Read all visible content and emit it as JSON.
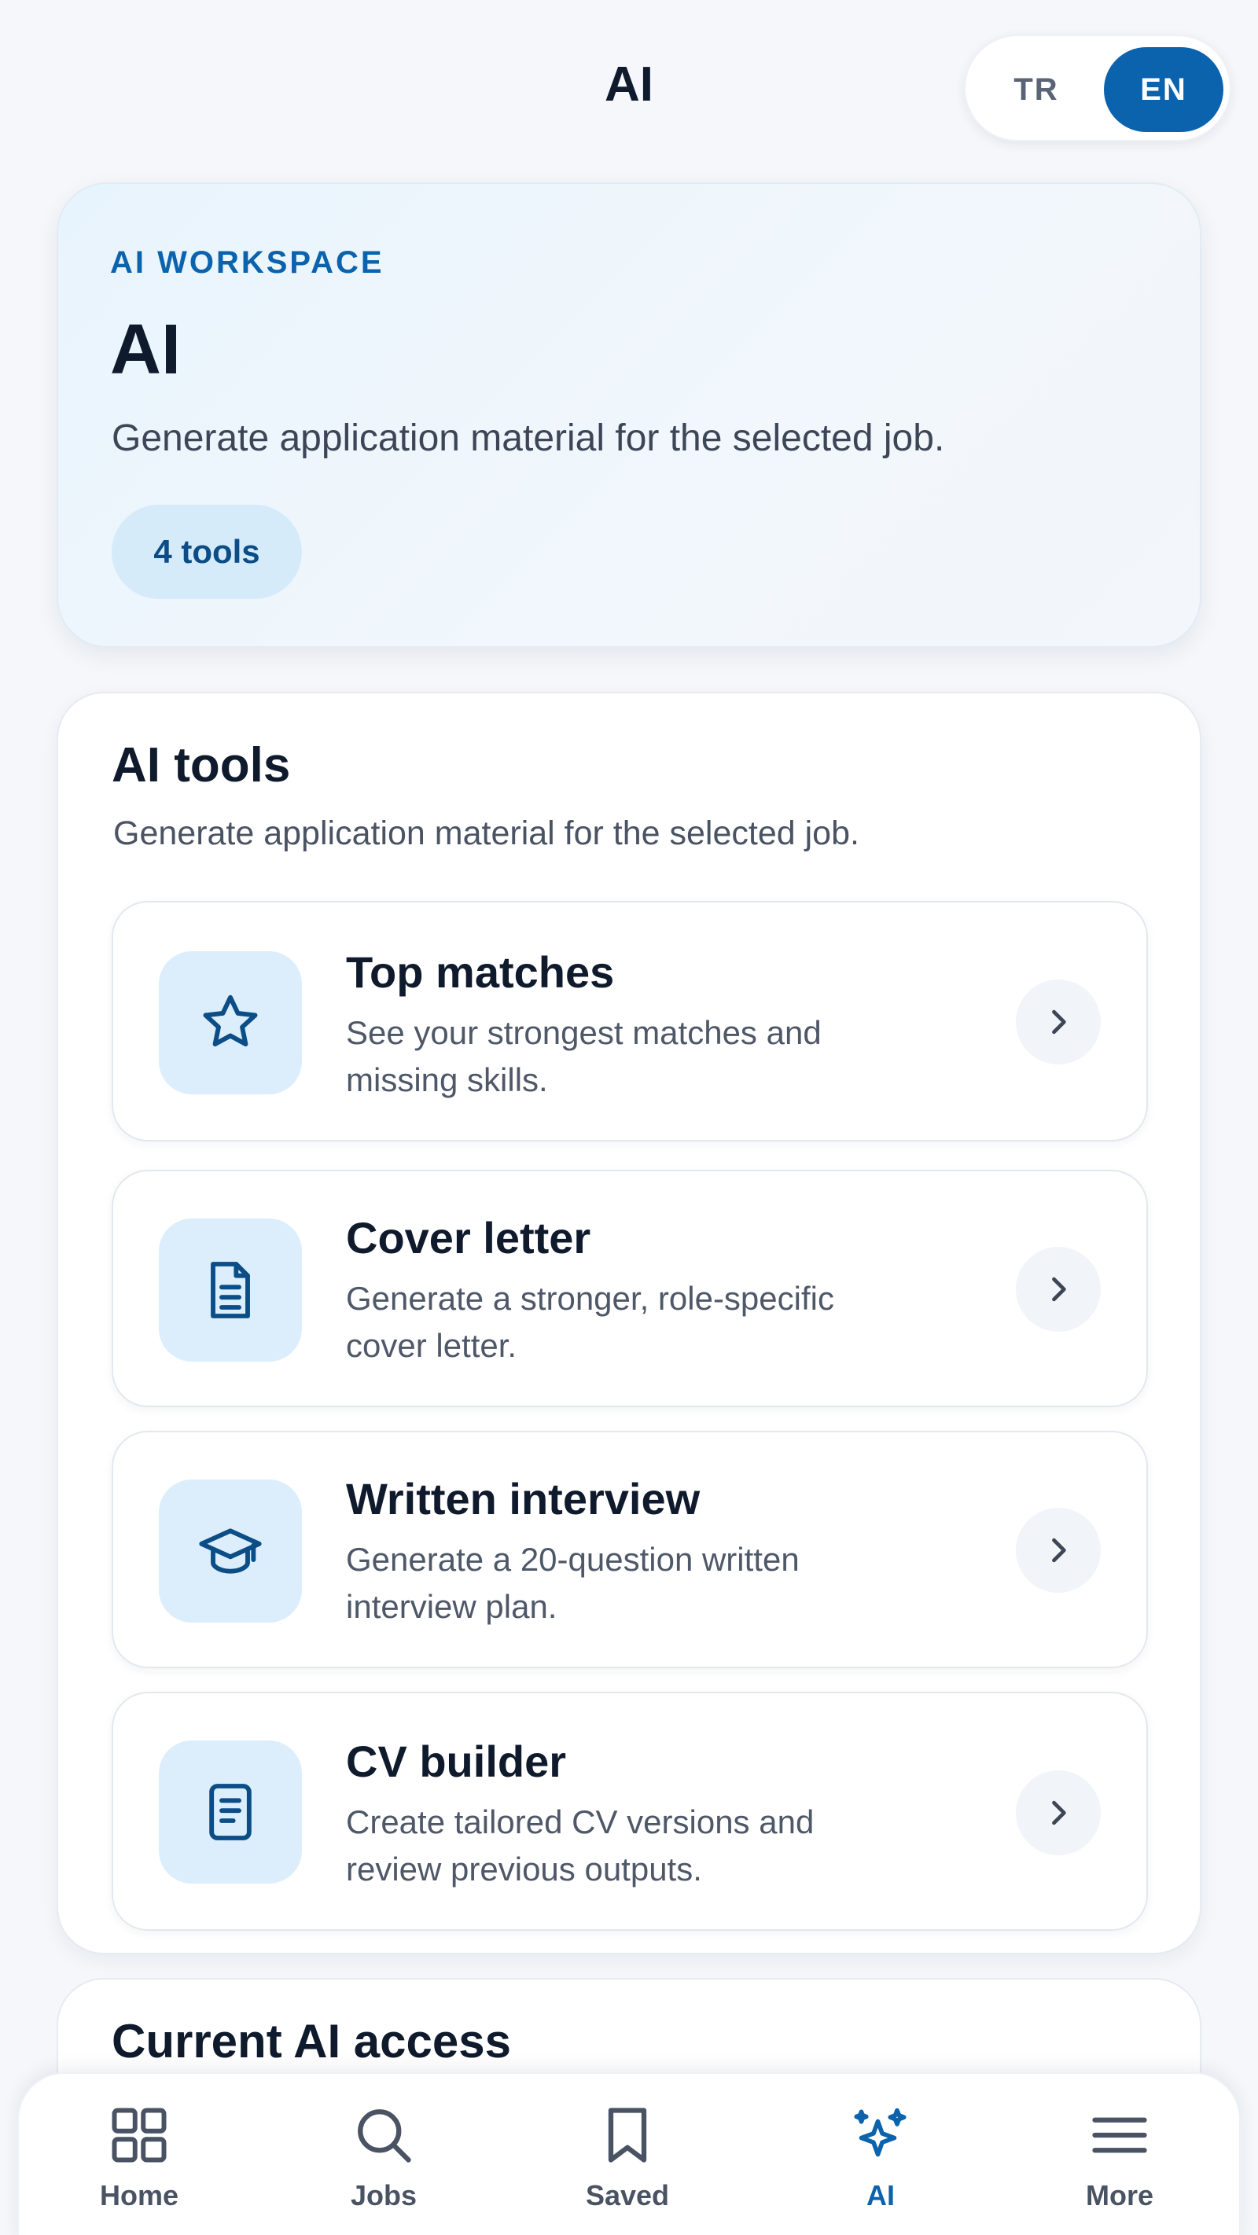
{
  "header": {
    "title": "AI",
    "languages": [
      {
        "label": "TR",
        "active": false
      },
      {
        "label": "EN",
        "active": true
      }
    ]
  },
  "hero": {
    "kicker": "AI WORKSPACE",
    "title": "AI",
    "subtitle": "Generate application material for the selected job.",
    "badge": "4 tools"
  },
  "tools": {
    "title": "AI tools",
    "subtitle": "Generate application material for the selected job.",
    "items": [
      {
        "name": "Top matches",
        "desc_line1": "See your strongest matches and",
        "desc_line2": "missing skills.",
        "icon": "star-icon"
      },
      {
        "name": "Cover letter",
        "desc_line1": "Generate a stronger, role-specific",
        "desc_line2": "cover letter.",
        "icon": "document-icon"
      },
      {
        "name": "Written interview",
        "desc_line1": "Generate a 20-question written",
        "desc_line2": "interview plan.",
        "icon": "graduation-cap-icon"
      },
      {
        "name": "CV builder",
        "desc_line1": "Create tailored CV versions and",
        "desc_line2": "review previous outputs.",
        "icon": "cv-file-icon"
      }
    ]
  },
  "access": {
    "title": "Current AI access"
  },
  "nav": {
    "items": [
      {
        "label": "Home",
        "icon": "grid-icon",
        "active": false
      },
      {
        "label": "Jobs",
        "icon": "search-icon",
        "active": false
      },
      {
        "label": "Saved",
        "icon": "bookmark-icon",
        "active": false
      },
      {
        "label": "AI",
        "icon": "sparkles-icon",
        "active": true
      },
      {
        "label": "More",
        "icon": "menu-icon",
        "active": false
      }
    ]
  },
  "colors": {
    "accent": "#0b63ad",
    "text": "#0f1b2d",
    "icon_bg": "#dcedfb"
  }
}
